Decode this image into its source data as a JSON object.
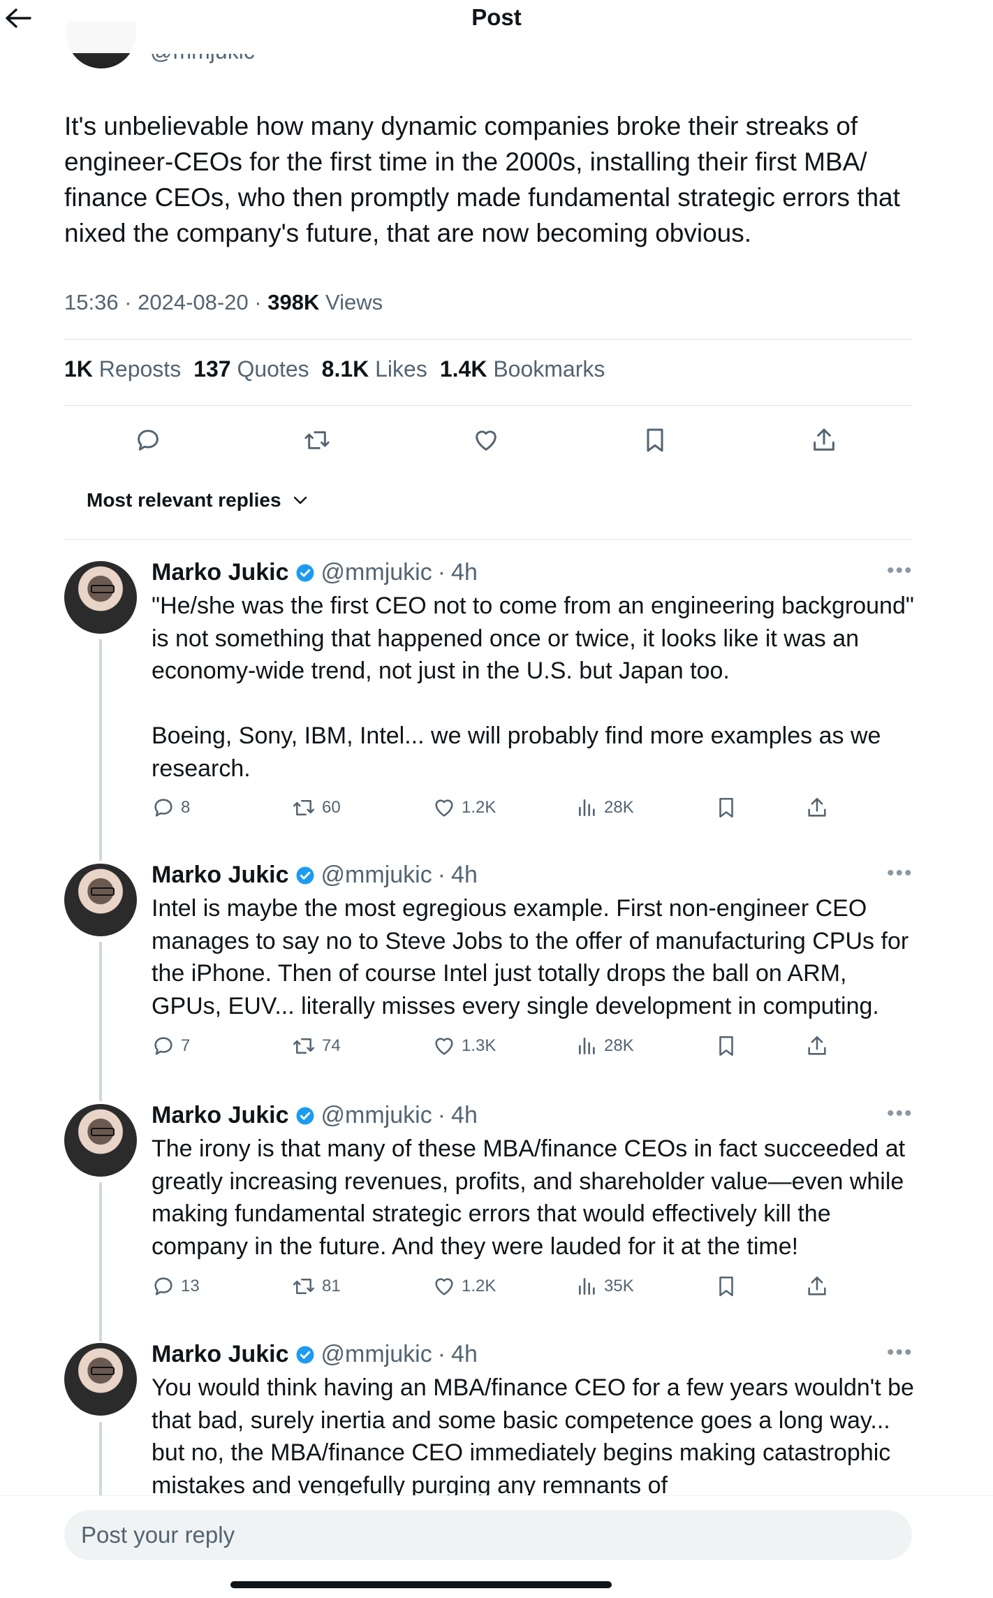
{
  "header": {
    "title": "Post",
    "peek_handle": "@mmjukic"
  },
  "post": {
    "text": "It's unbelievable how many dynamic companies broke their streaks of engineer-CEOs for the first time in the 2000s, installing their first MBA/ finance CEOs, who then promptly made fundamental strategic errors that nixed the company's future, that are now becoming obvious.",
    "time": "15:36",
    "date": "2024-08-20",
    "views_count": "398K",
    "views_label": "Views",
    "stats": [
      {
        "count": "1K",
        "label": "Reposts"
      },
      {
        "count": "137",
        "label": "Quotes"
      },
      {
        "count": "8.1K",
        "label": "Likes"
      },
      {
        "count": "1.4K",
        "label": "Bookmarks"
      }
    ]
  },
  "sort": {
    "label": "Most relevant replies"
  },
  "replies": [
    {
      "name": "Marko Jukic",
      "handle": "@mmjukic",
      "time": "4h",
      "text": "\"He/she was the first CEO not to come from an engineering background\" is not something that happened once or twice, it looks like it was an economy-wide trend, not just in the U.S. but Japan too.\n\nBoeing, Sony, IBM, Intel... we will probably find more examples as we research.",
      "replies": "8",
      "reposts": "60",
      "likes": "1.2K",
      "views": "28K"
    },
    {
      "name": "Marko Jukic",
      "handle": "@mmjukic",
      "time": "4h",
      "text": "Intel is maybe the most egregious example. First non-engineer CEO manages to say no to Steve Jobs to the offer of manufacturing CPUs for the iPhone. Then of course Intel just totally drops the ball on ARM, GPUs, EUV... literally misses every single development in computing.",
      "replies": "7",
      "reposts": "74",
      "likes": "1.3K",
      "views": "28K"
    },
    {
      "name": "Marko Jukic",
      "handle": "@mmjukic",
      "time": "4h",
      "text": "The irony is that many of these MBA/finance CEOs in fact succeeded at greatly increasing revenues, profits, and shareholder value—even while making fundamental strategic errors that would effectively kill the company in the future. And they were lauded for it at the time!",
      "replies": "13",
      "reposts": "81",
      "likes": "1.2K",
      "views": "35K"
    },
    {
      "name": "Marko Jukic",
      "handle": "@mmjukic",
      "time": "4h",
      "text": "You would think having an MBA/finance CEO for a few years wouldn't be that bad, surely inertia and some basic competence goes a long way... but no, the MBA/finance CEO immediately begins making catastrophic mistakes and vengefully purging any remnants of"
    }
  ],
  "composer": {
    "placeholder": "Post your reply"
  },
  "colors": {
    "verified": "#1d9bf0",
    "text": "#0f1419",
    "secondary": "#536471",
    "divider": "#dfe3e7"
  },
  "icons": [
    "back-arrow-icon",
    "reply-icon",
    "repost-icon",
    "like-icon",
    "bookmark-icon",
    "share-icon",
    "views-icon",
    "verified-badge-icon",
    "chevron-down-icon",
    "more-icon"
  ]
}
